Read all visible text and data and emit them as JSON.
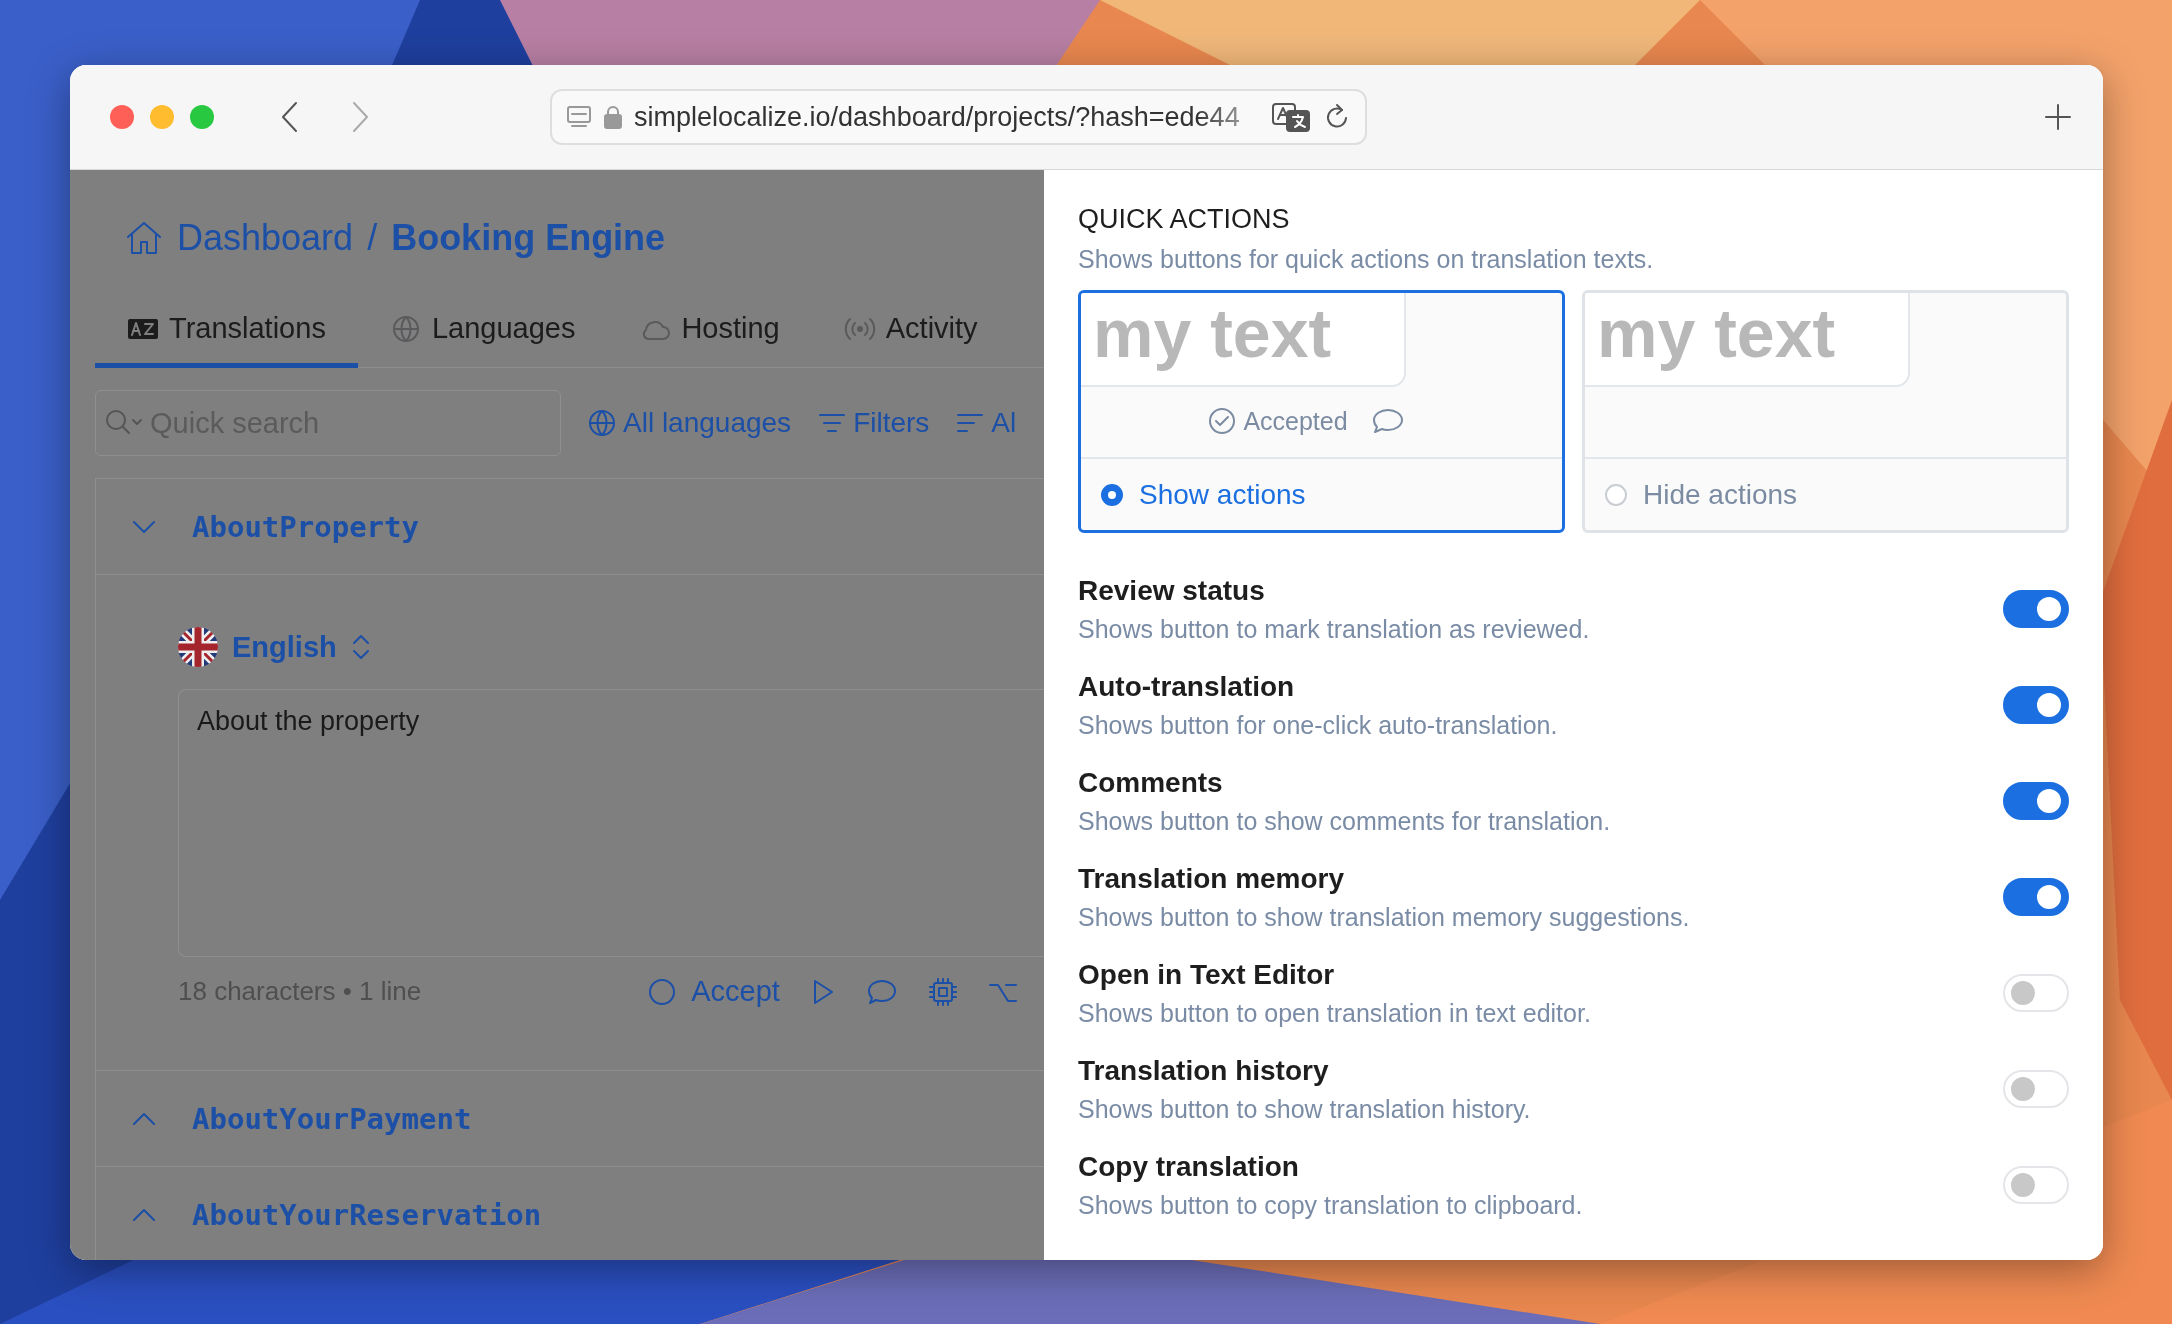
{
  "browser": {
    "url": "simplelocalize.io/dashboard/projects/?hash=ede44"
  },
  "breadcrumb": {
    "separator": "/",
    "items": [
      {
        "label": "Dashboard",
        "current": false
      },
      {
        "label": "Booking Engine",
        "current": true
      }
    ]
  },
  "tabs": [
    {
      "label": "Translations",
      "selected": true
    },
    {
      "label": "Languages",
      "selected": false
    },
    {
      "label": "Hosting",
      "selected": false
    },
    {
      "label": "Activity",
      "selected": false
    }
  ],
  "search": {
    "placeholder": "Quick search"
  },
  "toolbar_links": [
    {
      "label": "All languages"
    },
    {
      "label": "Filters"
    },
    {
      "label": "Al"
    }
  ],
  "sections": [
    {
      "key": "AboutProperty",
      "expanded": true,
      "language": "English",
      "text": "About the property",
      "stats": "18 characters • 1 line",
      "accept_label": "Accept"
    },
    {
      "key": "AboutYourPayment",
      "expanded": false
    },
    {
      "key": "AboutYourReservation",
      "expanded": false
    }
  ],
  "panel": {
    "title": "QUICK ACTIONS",
    "description": "Shows buttons for quick actions on translation texts.",
    "options": [
      {
        "preview_text": "my text",
        "preview_status": "Accepted",
        "label": "Show actions",
        "selected": true
      },
      {
        "preview_text": "my text",
        "label": "Hide actions",
        "selected": false
      }
    ],
    "toggles": [
      {
        "title": "Review status",
        "description": "Shows button to mark translation as reviewed.",
        "on": true
      },
      {
        "title": "Auto-translation",
        "description": "Shows button for one-click auto-translation.",
        "on": true
      },
      {
        "title": "Comments",
        "description": "Shows button to show comments for translation.",
        "on": true
      },
      {
        "title": "Translation memory",
        "description": "Shows button to show translation memory suggestions.",
        "on": true
      },
      {
        "title": "Open in Text Editor",
        "description": "Shows button to open translation in text editor.",
        "on": false
      },
      {
        "title": "Translation history",
        "description": "Shows button to show translation history.",
        "on": false
      },
      {
        "title": "Copy translation",
        "description": "Shows button to copy translation to clipboard.",
        "on": false
      }
    ]
  }
}
